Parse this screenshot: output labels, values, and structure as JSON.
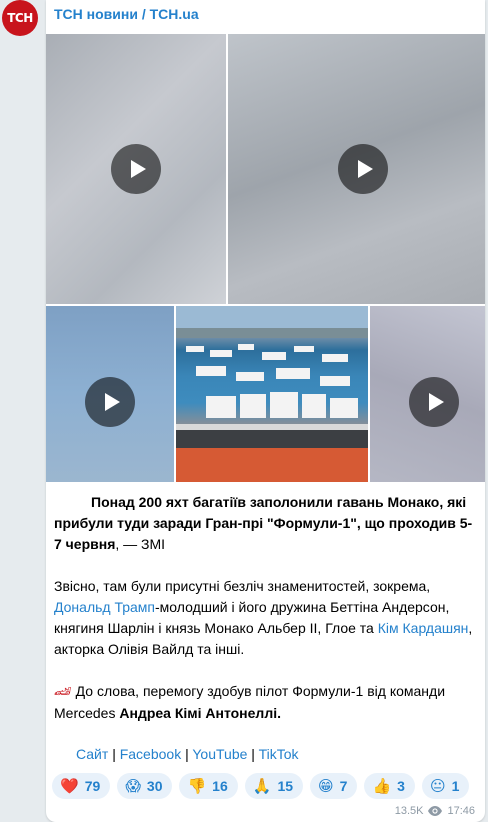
{
  "channel": {
    "logo_text": "ТСН",
    "name": "ТСН новини / TCH.ua"
  },
  "media": [
    {
      "kind": "video"
    },
    {
      "kind": "video"
    },
    {
      "kind": "video"
    },
    {
      "kind": "photo"
    },
    {
      "kind": "video"
    }
  ],
  "post": {
    "p1_bold": "Понад 200 яхт багатіїв заполонили гавань Монако, які прибули туди заради Гран-прі \"Формули-1\", що проходив 5-7 червня",
    "p1_rest": ", — ЗМІ",
    "p2_a": "Звісно, там були присутні безліч знаменитостей, зокрема, ",
    "p2_link1": "Дональд Трамп",
    "p2_b": "-молодший і його дружина Беттіна Андерсон, княгиня Шарлін і князь Монако Альбер II, Глое та ",
    "p2_link2": "Кім Кардашян",
    "p2_c": ", акторка Олівія Вайлд та інші.",
    "p3_icon": "race-car-icon",
    "p3_a": " До слова, перемогу здобув пілот Формули-1 від команди Mercedes ",
    "p3_bold": "Андреа Кімі Антонеллі.",
    "links": [
      "Сайт",
      "Facebook",
      "YouTube",
      "TikTok"
    ],
    "separator": "|"
  },
  "reactions": [
    {
      "emoji": "❤️",
      "count": "79"
    },
    {
      "emoji": "😱",
      "count": "30"
    },
    {
      "emoji": "👎",
      "count": "16"
    },
    {
      "emoji": "🙏",
      "count": "15"
    },
    {
      "emoji": "😁",
      "count": "7"
    },
    {
      "emoji": "👍",
      "count": "3"
    },
    {
      "emoji": "😐",
      "count": "1"
    }
  ],
  "meta": {
    "views": "13.5K",
    "time": "17:46",
    "eye_icon": "eye-icon"
  },
  "colors": {
    "link": "#2481cc",
    "logo_bg": "#c8141c",
    "reaction_bg": "#e8f1fa"
  }
}
